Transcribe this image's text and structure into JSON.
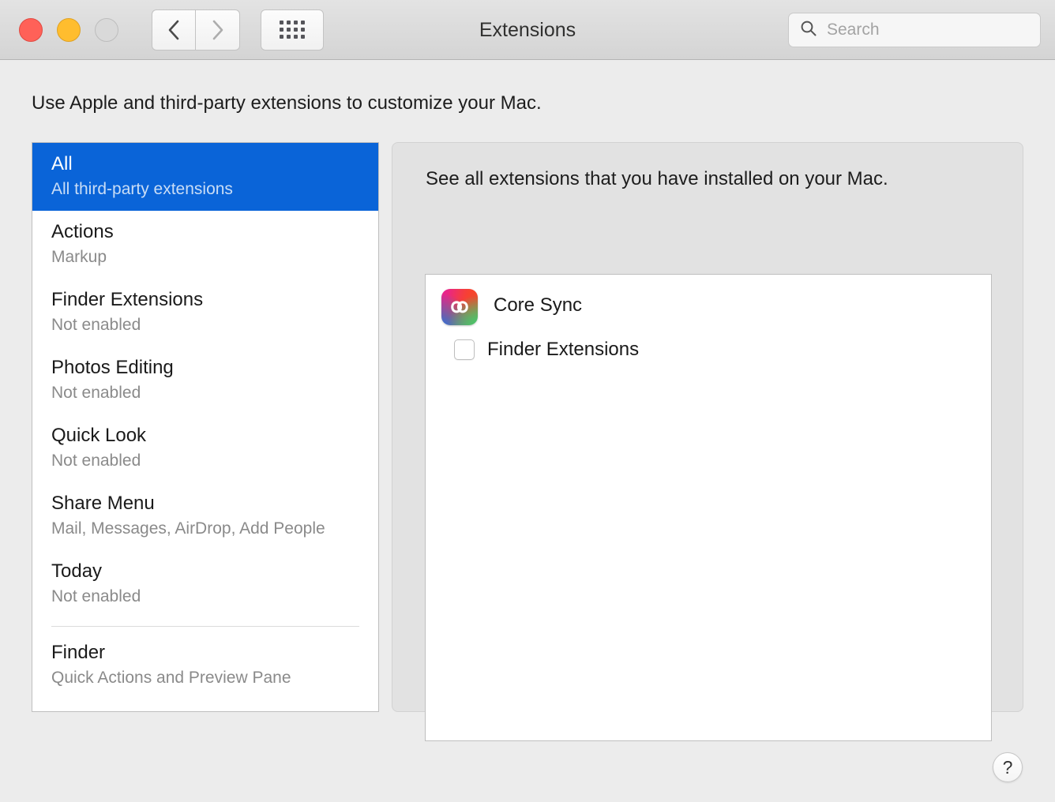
{
  "window": {
    "title": "Extensions",
    "traffic_lights": {
      "close": "close-button",
      "minimize": "minimize-button",
      "zoom": "zoom-button"
    },
    "nav": {
      "back": "back-button",
      "forward": "forward-button",
      "show_all": "show-all-button"
    },
    "search": {
      "placeholder": "Search",
      "value": ""
    },
    "colors": {
      "selection_blue": "#0A64D8",
      "close_red": "#FF6158",
      "minimize_amber": "#FFBD2E",
      "zoom_gray": "#D9D9D9",
      "window_bg": "#ECECEC",
      "panel_bg": "#E2E2E2"
    }
  },
  "intro": "Use Apple and third-party extensions to customize your Mac.",
  "sidebar": {
    "items": [
      {
        "title": "All",
        "subtitle": "All third-party extensions",
        "selected": true
      },
      {
        "title": "Actions",
        "subtitle": "Markup",
        "selected": false
      },
      {
        "title": "Finder Extensions",
        "subtitle": "Not enabled",
        "selected": false
      },
      {
        "title": "Photos Editing",
        "subtitle": "Not enabled",
        "selected": false
      },
      {
        "title": "Quick Look",
        "subtitle": "Not enabled",
        "selected": false
      },
      {
        "title": "Share Menu",
        "subtitle": "Mail, Messages, AirDrop, Add People",
        "selected": false
      },
      {
        "title": "Today",
        "subtitle": "Not enabled",
        "selected": false
      }
    ],
    "group_two": [
      {
        "title": "Finder",
        "subtitle": "Quick Actions and Preview Pane",
        "selected": false
      }
    ]
  },
  "detail": {
    "header": "See all extensions that you have installed on your Mac.",
    "extensions": [
      {
        "name": "Core Sync",
        "icon": "adobe-creative-cloud-icon",
        "options": [
          {
            "label": "Finder Extensions",
            "checked": false
          }
        ]
      }
    ]
  },
  "help": {
    "label": "?"
  }
}
